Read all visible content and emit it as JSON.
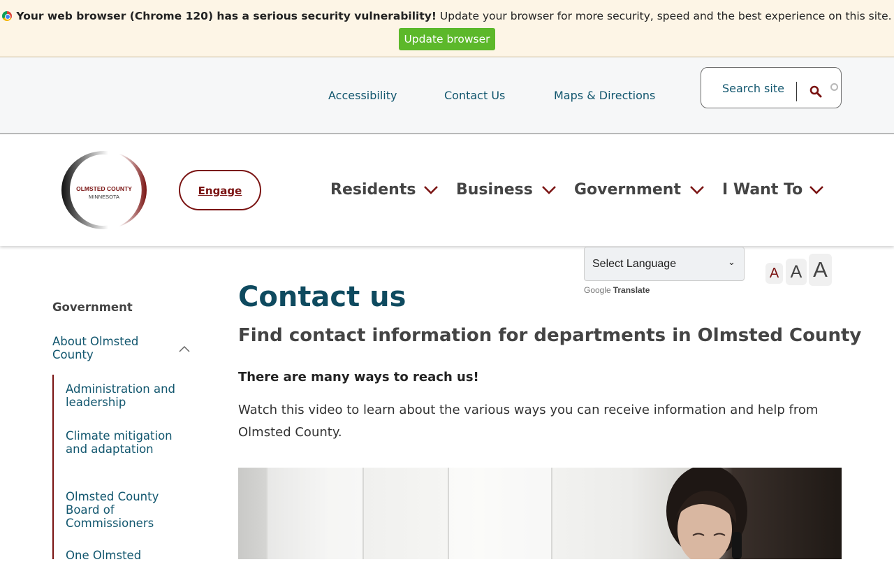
{
  "banner": {
    "bold_text": "Your web browser (Chrome 120) has a serious security vulnerability!",
    "text": "Update your browser for more security, speed and the best experience on this site.",
    "button": "Update browser"
  },
  "utility": {
    "links": [
      "Accessibility",
      "Contact Us",
      "Maps & Directions"
    ],
    "search_label": "Search site"
  },
  "logo": {
    "line1": "OLMSTED COUNTY",
    "line2": "MINNESOTA",
    "colors": {
      "dark": "#7a1312",
      "black": "#111111"
    }
  },
  "header": {
    "engage": "Engage",
    "nav": [
      "Residents",
      "Business",
      "Government",
      "I Want To"
    ]
  },
  "language": {
    "select": "Select Language",
    "powered_by": "Google",
    "translate": "Translate"
  },
  "font_size": {
    "labels": [
      "A",
      "A",
      "A"
    ]
  },
  "sidebar": {
    "title": "Government",
    "parent": "About Olmsted County",
    "children": [
      "Administration and leadership",
      "Climate mitigation and adaptation",
      "Olmsted County Board of Commissioners",
      "One Olmsted"
    ]
  },
  "content": {
    "title": "Contact us",
    "subtitle": "Find contact information for departments in Olmsted County",
    "lead": "There are many ways to reach us!",
    "paragraph": "Watch this video to learn about the various ways you can receive information and help from Olmsted County."
  },
  "colors": {
    "accent": "#7a1312",
    "link": "#11566e",
    "title": "#0e4a5f",
    "update_green": "#5cb82a"
  }
}
